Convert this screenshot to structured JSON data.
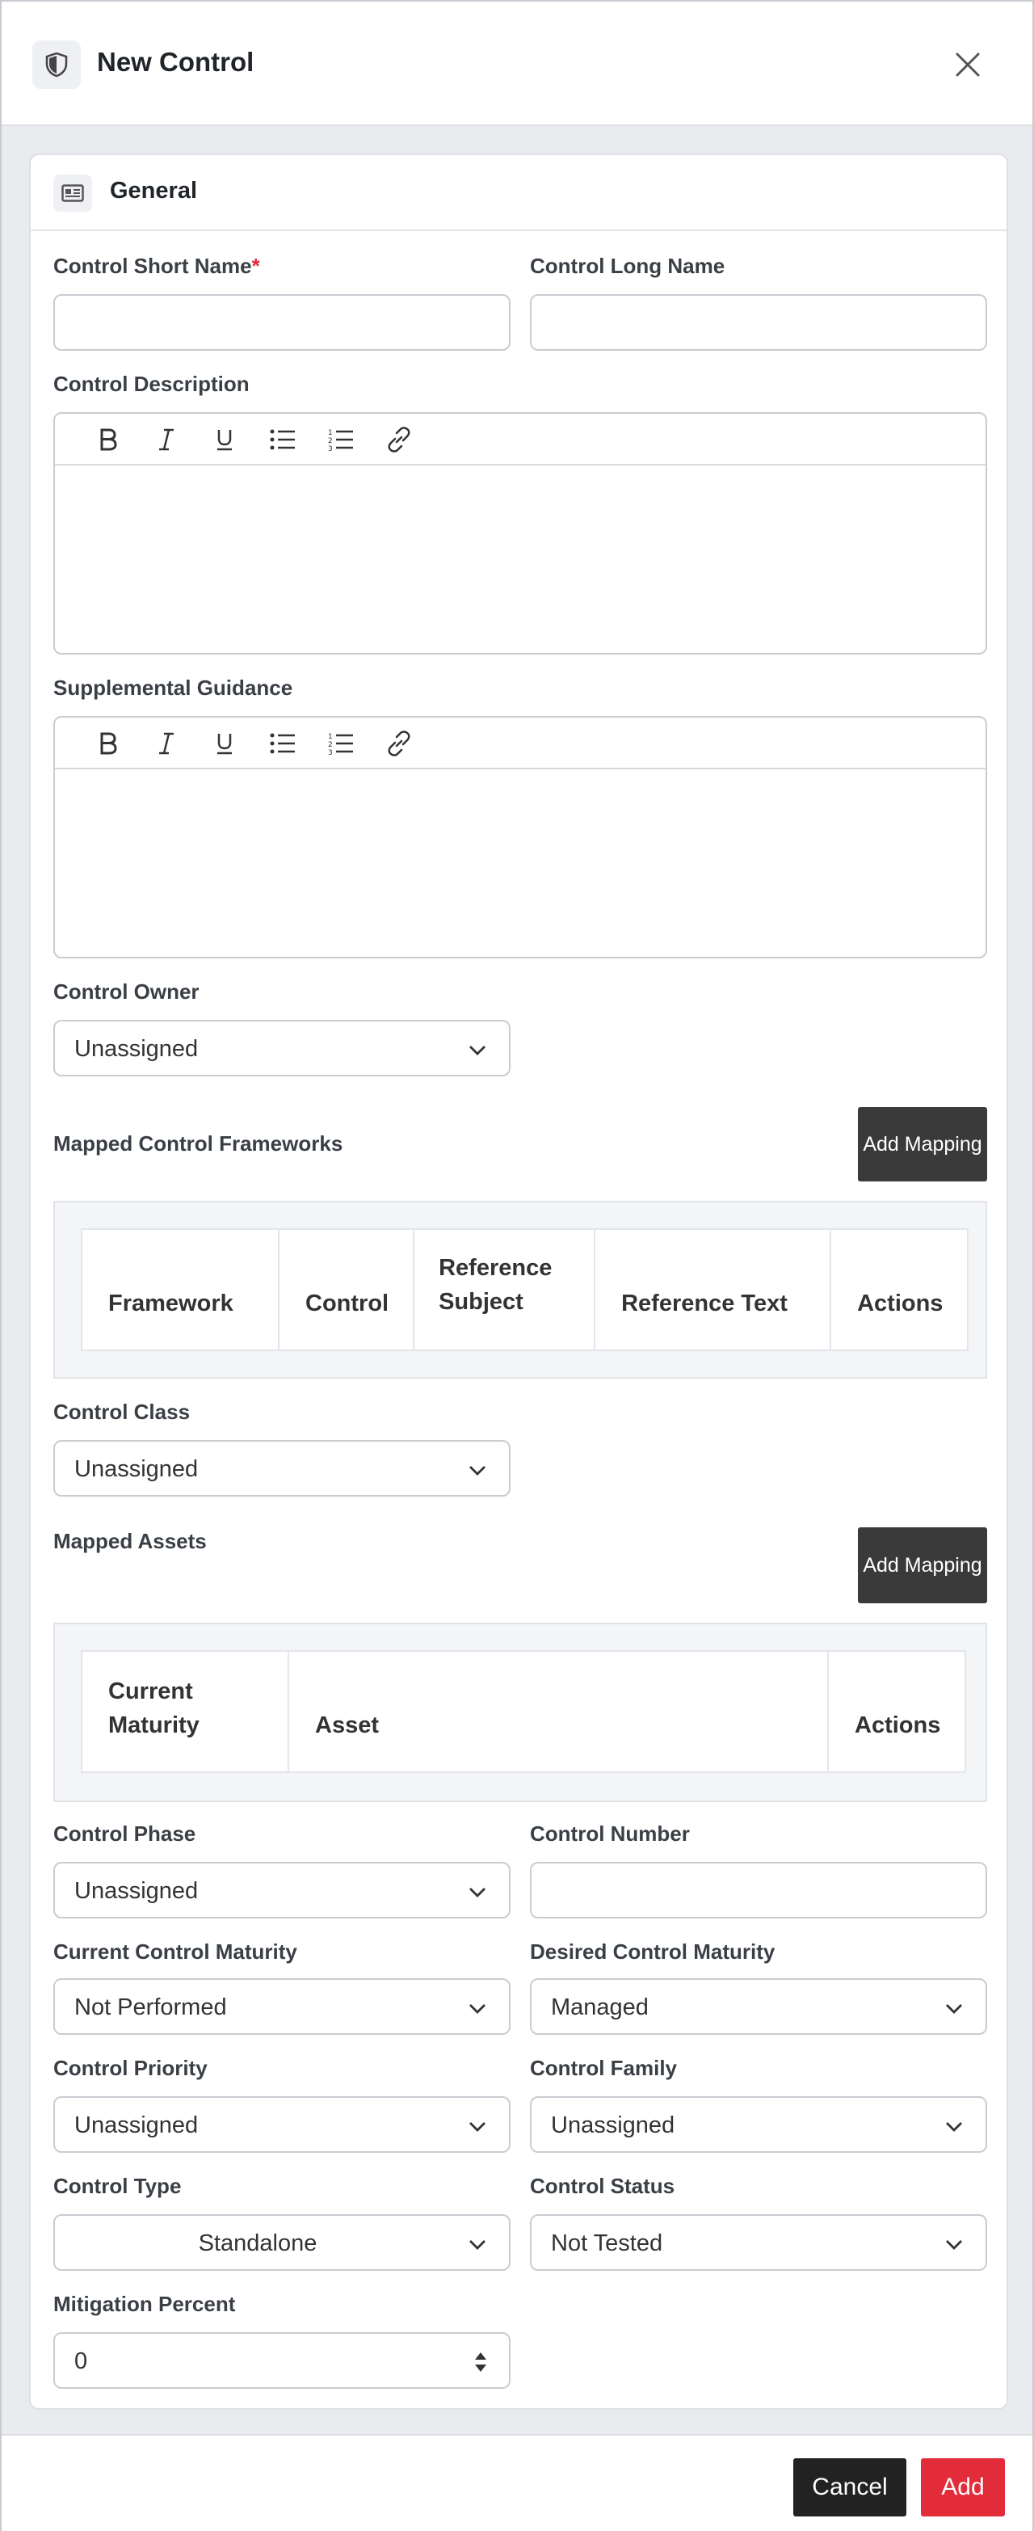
{
  "header": {
    "title": "New Control",
    "icon": "shield-icon",
    "close_icon": "close-icon"
  },
  "general": {
    "title": "General",
    "icon": "id-card-icon",
    "short_name": {
      "label": "Control Short Name",
      "required_mark": "*",
      "value": ""
    },
    "long_name": {
      "label": "Control Long Name",
      "value": ""
    },
    "description": {
      "label": "Control Description",
      "value": ""
    },
    "guidance": {
      "label": "Supplemental Guidance",
      "value": ""
    },
    "toolbar_icons": [
      "bold-icon",
      "italic-icon",
      "underline-icon",
      "bullet-list-icon",
      "numbered-list-icon",
      "link-icon"
    ],
    "owner": {
      "label": "Control Owner",
      "value": "Unassigned"
    },
    "frameworks": {
      "label": "Mapped Control Frameworks",
      "button": "Add Mapping",
      "columns": [
        "Framework",
        "Control",
        "Reference Subject",
        "Reference Text",
        "Actions"
      ]
    },
    "control_class": {
      "label": "Control Class",
      "value": "Unassigned"
    },
    "assets": {
      "label": "Mapped Assets",
      "button": "Add Mapping",
      "columns": [
        "Current Maturity",
        "Asset",
        "Actions"
      ]
    },
    "phase": {
      "label": "Control Phase",
      "value": "Unassigned"
    },
    "number": {
      "label": "Control Number",
      "value": ""
    },
    "current_maturity": {
      "label": "Current Control Maturity",
      "value": "Not Performed"
    },
    "desired_maturity": {
      "label": "Desired Control Maturity",
      "value": "Managed"
    },
    "priority": {
      "label": "Control Priority",
      "value": "Unassigned"
    },
    "family": {
      "label": "Control Family",
      "value": "Unassigned"
    },
    "type": {
      "label": "Control Type",
      "value": "Standalone"
    },
    "status": {
      "label": "Control Status",
      "value": "Not Tested"
    },
    "mitigation": {
      "label": "Mitigation Percent",
      "value": "0"
    }
  },
  "footer": {
    "cancel": "Cancel",
    "add": "Add"
  },
  "colors": {
    "add_button": "#e22c3a",
    "dark_button": "#3a3a3a",
    "required": "#e0283a"
  }
}
